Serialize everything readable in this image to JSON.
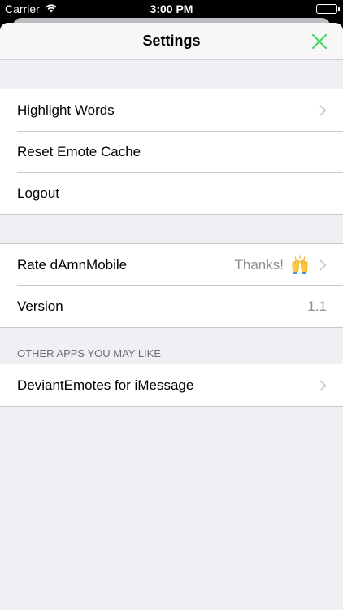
{
  "status": {
    "carrier": "Carrier",
    "time": "3:00 PM"
  },
  "nav": {
    "title": "Settings",
    "close_icon": "close-x-icon",
    "accent": "#4cd964"
  },
  "section1": {
    "rows": [
      {
        "label": "Highlight Words",
        "chevron": true
      },
      {
        "label": "Reset Emote Cache",
        "chevron": false
      },
      {
        "label": "Logout",
        "chevron": false
      }
    ]
  },
  "section2": {
    "rows": [
      {
        "label": "Rate dAmnMobile",
        "detail": "Thanks!",
        "icon": "raising-hands-emoji-icon",
        "chevron": true
      },
      {
        "label": "Version",
        "detail": "1.1",
        "chevron": false
      }
    ]
  },
  "section3": {
    "header": "OTHER APPS YOU MAY LIKE",
    "rows": [
      {
        "label": "DeviantEmotes for iMessage",
        "chevron": true
      }
    ]
  }
}
